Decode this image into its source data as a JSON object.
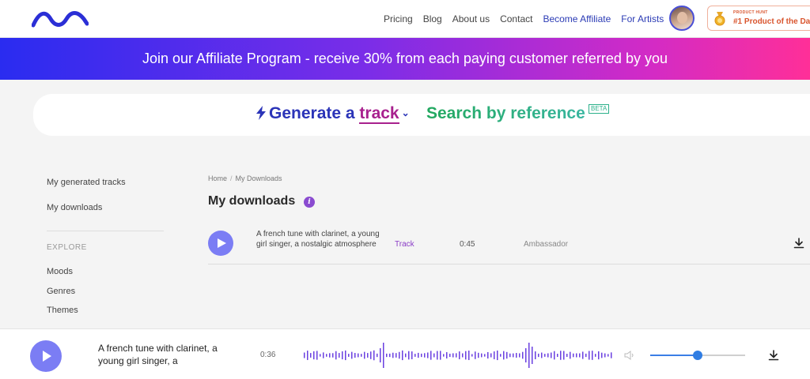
{
  "nav": {
    "links": [
      {
        "label": "Pricing",
        "accent": false
      },
      {
        "label": "Blog",
        "accent": false
      },
      {
        "label": "About us",
        "accent": false
      },
      {
        "label": "Contact",
        "accent": false
      },
      {
        "label": "Become Affiliate",
        "accent": true
      },
      {
        "label": "For Artists",
        "accent": true
      }
    ],
    "badge_small": "PRODUCT HUNT",
    "badge_big": "#1 Product of the Day"
  },
  "banner": {
    "text": "Join our Affiliate Program - receive 30% from each paying customer referred by you"
  },
  "generator": {
    "generate_word1": "Generate a",
    "generate_word2": "track",
    "search_label": "Search by reference",
    "beta_label": "BETA"
  },
  "sidebar": {
    "items": [
      "My generated tracks",
      "My downloads"
    ],
    "explore_heading": "EXPLORE",
    "explore_items": [
      "Moods",
      "Genres",
      "Themes"
    ]
  },
  "breadcrumb": {
    "home": "Home",
    "separator": "/",
    "current": "My Downloads"
  },
  "page": {
    "title": "My downloads",
    "info_glyph": "i"
  },
  "downloads": [
    {
      "description": "A french tune with clarinet, a young girl singer, a nostalgic atmosphere",
      "type": "Track",
      "duration": "0:45",
      "license": "Ambassador"
    }
  ],
  "player": {
    "title": "A french tune with clarinet, a young girl singer, a",
    "time": "0:36",
    "volume_fraction": 0.5
  },
  "colors": {
    "brand_blue": "#2b34b8",
    "accent_purple": "#8a3cc6",
    "play_button": "#7b7df4"
  },
  "icons": [
    "logo-wave-icon",
    "medal-icon",
    "bolt-icon",
    "chevron-down-icon",
    "info-icon",
    "play-icon",
    "download-icon",
    "volume-icon"
  ]
}
